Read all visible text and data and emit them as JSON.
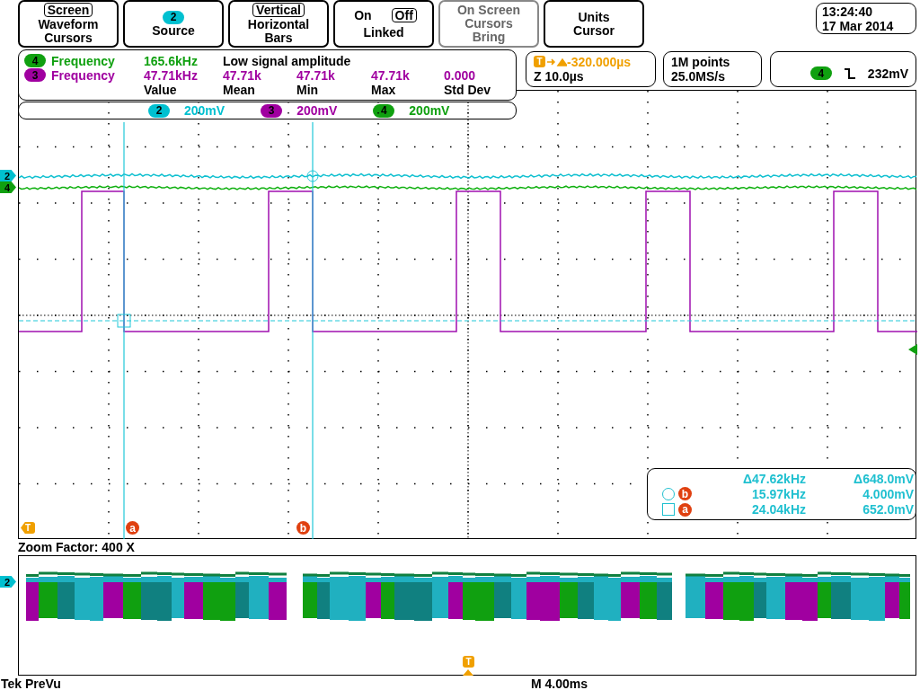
{
  "menu": [
    {
      "kind": "stacked_options",
      "options": [
        {
          "label": "Screen",
          "selected": true
        },
        {
          "label": "Waveform",
          "selected": false
        }
      ],
      "lines": [
        "Cursors"
      ],
      "disabled": false
    },
    {
      "kind": "source",
      "badge": {
        "number": "2",
        "color": "#00c0d0"
      },
      "lines": [
        "Source"
      ],
      "disabled": false
    },
    {
      "kind": "stacked_options",
      "options": [
        {
          "label": "Vertical",
          "selected": true
        },
        {
          "label": "Horizontal",
          "selected": false
        }
      ],
      "lines": [
        "Bars"
      ],
      "disabled": false
    },
    {
      "kind": "inline_options",
      "options": [
        {
          "label": "On",
          "selected": false
        },
        {
          "label": "Off",
          "selected": true
        }
      ],
      "lines": [
        "Linked"
      ],
      "disabled": false
    },
    {
      "kind": "text",
      "lines": [
        "On Screen",
        "Cursors",
        "Bring"
      ],
      "disabled": true
    },
    {
      "kind": "text",
      "lines": [
        "Units",
        "Cursor"
      ],
      "disabled": false
    }
  ],
  "clock": {
    "time": "13:24:40",
    "date": "17 Mar 2014"
  },
  "measurements": {
    "rows": [
      {
        "channel": "4",
        "color": "#10a010",
        "name": "Frequency",
        "values": [
          "165.6kHz"
        ],
        "note": "Low signal amplitude"
      },
      {
        "channel": "3",
        "color": "#a000a0",
        "name": "Frequency",
        "values": [
          "47.71kHz",
          "47.71k",
          "47.71k",
          "47.71k",
          "0.000"
        ]
      }
    ],
    "columns": [
      "Value",
      "Mean",
      "Min",
      "Max",
      "Std Dev"
    ]
  },
  "horizontal": {
    "trigger_marker": "T",
    "trigger_delay": "-320.000µs",
    "zoom_scale": "Z 10.0µs"
  },
  "acquisition": {
    "record_length": "1M points",
    "sample_rate": "25.0MS/s"
  },
  "trigger": {
    "channel": "4",
    "color": "#10a010",
    "level": "232mV"
  },
  "vertical_scales": [
    {
      "number": "2",
      "color": "#00c0d0",
      "scale": "200mV"
    },
    {
      "number": "3",
      "color": "#a000a0",
      "scale": "200mV"
    },
    {
      "number": "4",
      "color": "#10a010",
      "scale": "200mV"
    }
  ],
  "graticule": {
    "channel_markers": [
      {
        "number": "2",
        "color": "#00c0d0"
      },
      {
        "number": "4",
        "color": "#10a010"
      }
    ],
    "cursor_readout": {
      "delta": {
        "frequency": "Δ47.62kHz",
        "voltage": "Δ648.0mV"
      },
      "rows": [
        {
          "kind": "circle",
          "label": "b",
          "frequency": "15.97kHz",
          "voltage": "4.000mV"
        },
        {
          "kind": "square",
          "label": "a",
          "frequency": "24.04kHz",
          "voltage": "652.0mV"
        }
      ]
    },
    "trigger_marker": "T",
    "cursor_markers": [
      {
        "label": "a"
      },
      {
        "label": "b"
      }
    ]
  },
  "zoom_factor": "Zoom Factor: 400 X",
  "zoom_window": {
    "channel_marker": {
      "number": "2",
      "color": "#00c0d0"
    },
    "trigger_marker": "T"
  },
  "header": {
    "title": "Tek PreVu",
    "timebase": "M 4.00ms"
  }
}
